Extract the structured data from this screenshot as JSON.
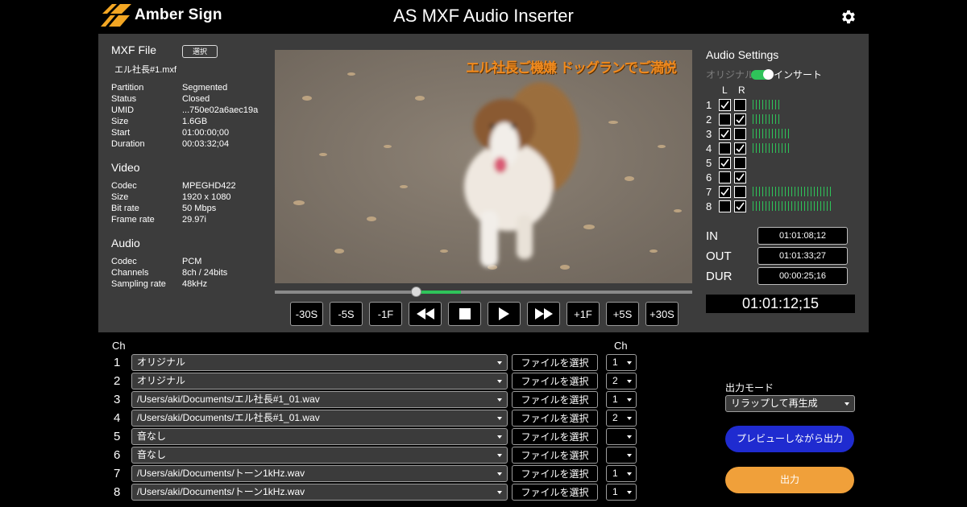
{
  "app": {
    "brand": "Amber Sign",
    "title": "AS MXF Audio Inserter",
    "settings_icon": "gear-icon"
  },
  "colors": {
    "accent_green": "#2fc35a",
    "preview_blue": "#1f2bd0",
    "export_orange": "#f0a03a",
    "subtitle_orange": "#f08a1e"
  },
  "info": {
    "mxf_title": "MXF File",
    "select_label": "選択",
    "filename": "エル社長#1.mxf",
    "mxf_props": [
      {
        "k": "Partition",
        "v": "Segmented"
      },
      {
        "k": "Status",
        "v": "Closed"
      },
      {
        "k": "UMID",
        "v": "...750e02a6aec19a"
      },
      {
        "k": "Size",
        "v": "1.6GB"
      },
      {
        "k": "Start",
        "v": "01:00:00;00"
      },
      {
        "k": "Duration",
        "v": "00:03:32;04"
      }
    ],
    "video_title": "Video",
    "video_props": [
      {
        "k": "Codec",
        "v": "MPEGHD422"
      },
      {
        "k": "Size",
        "v": "1920 x 1080"
      },
      {
        "k": "Bit rate",
        "v": "50 Mbps"
      },
      {
        "k": "Frame rate",
        "v": "29.97i"
      }
    ],
    "audio_title": "Audio",
    "audio_props": [
      {
        "k": "Codec",
        "v": "PCM"
      },
      {
        "k": "Channels",
        "v": "8ch / 24bits"
      },
      {
        "k": "Sampling rate",
        "v": "48kHz"
      }
    ]
  },
  "player": {
    "subtitle": "エル社長ご機嫌 ドッグランでご満悦",
    "progress_fraction": 0.34,
    "transport": [
      {
        "label": "-30S",
        "name": "back-30s-button"
      },
      {
        "label": "-5S",
        "name": "back-5s-button"
      },
      {
        "label": "-1F",
        "name": "back-1f-button"
      },
      {
        "label": "",
        "name": "rewind-button",
        "icon": "rewind-icon"
      },
      {
        "label": "",
        "name": "stop-button",
        "icon": "stop-icon"
      },
      {
        "label": "",
        "name": "play-button",
        "icon": "play-icon"
      },
      {
        "label": "",
        "name": "fast-forward-button",
        "icon": "fast-forward-icon"
      },
      {
        "label": "+1F",
        "name": "forward-1f-button"
      },
      {
        "label": "+5S",
        "name": "forward-5s-button"
      },
      {
        "label": "+30S",
        "name": "forward-30s-button"
      }
    ]
  },
  "audio_settings": {
    "title": "Audio Settings",
    "mode_original": "オリジナル",
    "mode_insert": "インサート",
    "col_l": "L",
    "col_r": "R",
    "channels": [
      {
        "num": "1",
        "l": true,
        "r": false,
        "level": 9
      },
      {
        "num": "2",
        "l": false,
        "r": true,
        "level": 9
      },
      {
        "num": "3",
        "l": true,
        "r": false,
        "level": 12
      },
      {
        "num": "4",
        "l": false,
        "r": true,
        "level": 12
      },
      {
        "num": "5",
        "l": true,
        "r": false,
        "level": 0
      },
      {
        "num": "6",
        "l": false,
        "r": true,
        "level": 0
      },
      {
        "num": "7",
        "l": true,
        "r": false,
        "level": 25
      },
      {
        "num": "8",
        "l": false,
        "r": true,
        "level": 25
      }
    ],
    "in_label": "IN",
    "in_value": "01:01:08;12",
    "out_label": "OUT",
    "out_value": "01:01:33;27",
    "dur_label": "DUR",
    "dur_value": "00:00:25;16",
    "current_tc": "01:01:12;15"
  },
  "mapping": {
    "ch_header": "Ch",
    "ch_header2": "Ch",
    "file_button_label": "ファイルを選択",
    "rows": [
      {
        "num": "1",
        "source": "オリジナル",
        "ch": "1"
      },
      {
        "num": "2",
        "source": "オリジナル",
        "ch": "2"
      },
      {
        "num": "3",
        "source": "/Users/aki/Documents/エル社長#1_01.wav",
        "ch": "1"
      },
      {
        "num": "4",
        "source": "/Users/aki/Documents/エル社長#1_01.wav",
        "ch": "2"
      },
      {
        "num": "5",
        "source": "音なし",
        "ch": ""
      },
      {
        "num": "6",
        "source": "音なし",
        "ch": ""
      },
      {
        "num": "7",
        "source": "/Users/aki/Documents/トーン1kHz.wav",
        "ch": "1"
      },
      {
        "num": "8",
        "source": "/Users/aki/Documents/トーン1kHz.wav",
        "ch": "1"
      }
    ]
  },
  "output": {
    "mode_label": "出力モード",
    "mode_value": "リラップして再生成",
    "preview_label": "プレビューしながら出力",
    "export_label": "出力"
  }
}
